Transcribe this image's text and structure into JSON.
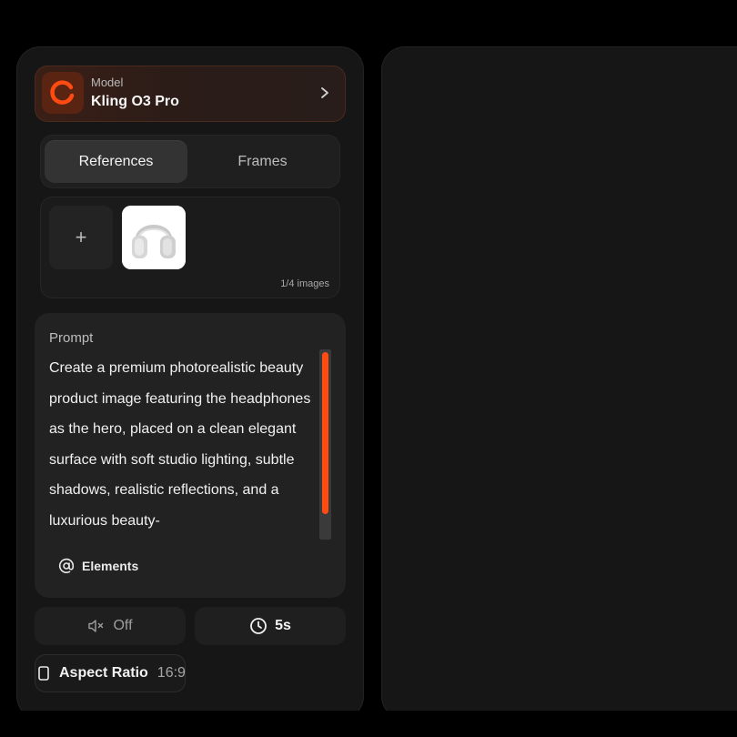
{
  "model": {
    "kicker": "Model",
    "name": "Kling O3 Pro"
  },
  "tabs": [
    {
      "label": "References",
      "active": true
    },
    {
      "label": "Frames",
      "active": false
    }
  ],
  "references": {
    "add_symbol": "+",
    "count_text": "1/4 images"
  },
  "prompt": {
    "label": "Prompt",
    "text": "Create a premium photorealistic beauty product image featuring the headphones as the hero, placed on a clean elegant surface with soft studio lighting, subtle shadows, realistic reflections, and a luxurious beauty-",
    "elements_label": "Elements"
  },
  "controls": {
    "audio_label": "Off",
    "duration_label": "5s",
    "aspect_label": "Aspect Ratio",
    "aspect_value": "16:9"
  },
  "colors": {
    "accent": "#ff4a12",
    "panel_bg": "#161616"
  }
}
